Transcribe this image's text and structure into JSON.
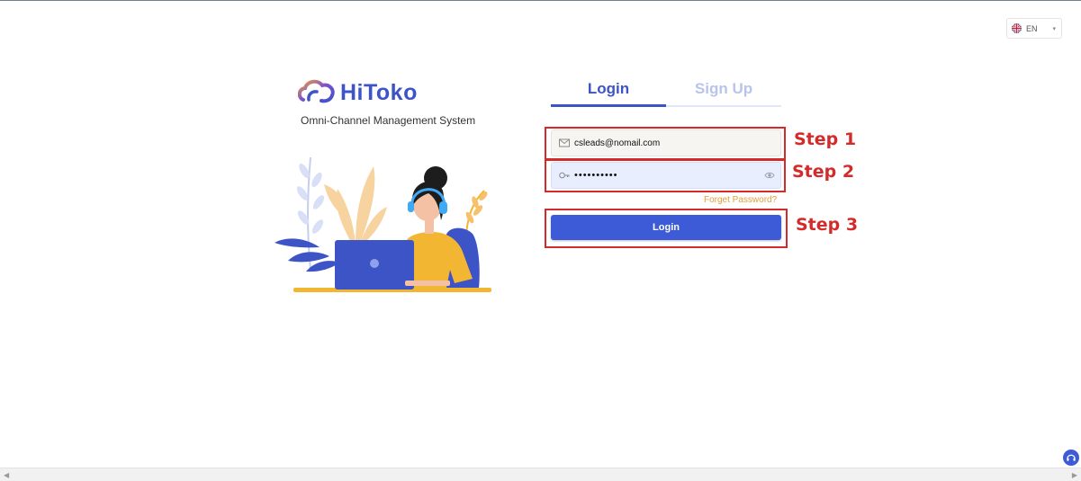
{
  "language": {
    "label": "EN",
    "icon": "uk-flag-icon",
    "caret": "▾"
  },
  "brand": {
    "name": "HiToko",
    "subtitle": "Omni-Channel Management System",
    "color": "#3d54c7"
  },
  "tabs": [
    {
      "label": "Login",
      "active": true
    },
    {
      "label": "Sign Up",
      "active": false
    }
  ],
  "form": {
    "email": {
      "value": "csleads@nomail.com",
      "icon": "mail-icon"
    },
    "password": {
      "value": "••••••••••",
      "icon": "key-icon",
      "toggle_icon": "eye-icon"
    },
    "forgot_label": "Forget Password?",
    "submit_label": "Login"
  },
  "annotations": [
    {
      "label": "Step 1",
      "color": "#d42a2a"
    },
    {
      "label": "Step 2",
      "color": "#d42a2a"
    },
    {
      "label": "Step 3",
      "color": "#d42a2a"
    }
  ],
  "colors": {
    "accent": "#3d5bd6",
    "link": "#e0a03a"
  }
}
